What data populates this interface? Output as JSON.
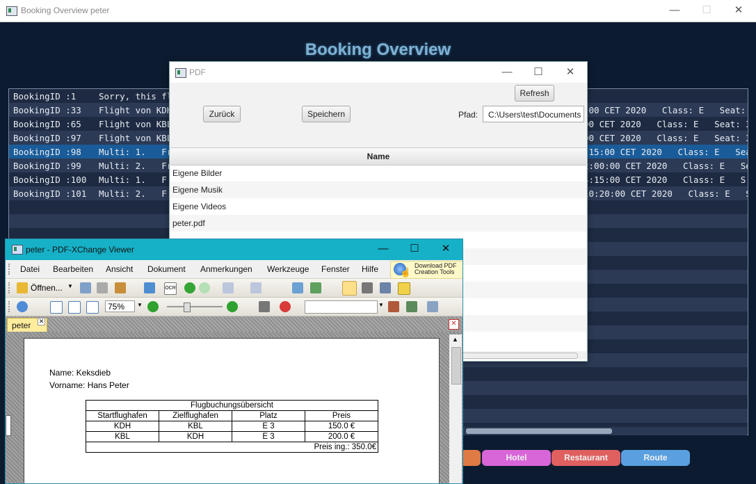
{
  "main_window": {
    "title": "Booking Overview peter",
    "heading": "Booking Overview",
    "bookings": [
      {
        "c1": "BookingID :1",
        "c2": "Sorry, this fli",
        "c3": ""
      },
      {
        "c1": "BookingID :33",
        "c2": "Flight von KDH",
        "c3": ":00 CET 2020   Class: E   Seat:"
      },
      {
        "c1": "BookingID :65",
        "c2": "Flight von KBL",
        "c3": "00 CET 2020   Class: E   Seat: 3"
      },
      {
        "c1": "BookingID :97",
        "c2": "Flight von KBL",
        "c3": "00 CET 2020   Class: E   Seat: 3"
      },
      {
        "c1": "BookingID :98",
        "c2": "Multi: 1.   Fr",
        "c3": ":15:00 CET 2020   Class: E   Sea"
      },
      {
        "c1": "BookingID :99",
        "c2": "Multi: 2.   Fr",
        "c3": "2:00:00 CET 2020   Class: E   Se"
      },
      {
        "c1": "BookingID :100",
        "c2": "Multi: 1.   F",
        "c3": "4:15:00 CET 2020   Class: E   S"
      },
      {
        "c1": "BookingID :101",
        "c2": "Multi: 2.   F",
        "c3": "10:20:00 CET 2020   Class: E   S"
      }
    ],
    "selected_index": 4,
    "nav_buttons": [
      {
        "label": "Hotel",
        "color": "#d866d8"
      },
      {
        "label": "Restaurant",
        "color": "#e06060"
      },
      {
        "label": "Route",
        "color": "#5aa0e0"
      }
    ]
  },
  "pdf_window": {
    "title": "PDF",
    "refresh_label": "Refresh",
    "back_label": "Zurück",
    "save_label": "Speichern",
    "path_label": "Pfad:",
    "path_value": "C:\\Users\\test\\Documents",
    "column_header": "Name",
    "files": [
      "Eigene Bilder",
      "Eigene Musik",
      "Eigene Videos",
      "peter.pdf"
    ]
  },
  "viewer": {
    "title": "peter - PDF-XChange Viewer",
    "menu": [
      "Datei",
      "Bearbeiten",
      "Ansicht",
      "Dokument",
      "Anmerkungen",
      "Werkzeuge",
      "Fenster",
      "Hilfe"
    ],
    "download_line1": "Download PDF",
    "download_line2": "Creation Tools",
    "open_label": "Öffnen...",
    "zoom_value": "75%",
    "tab_label": "peter",
    "document": {
      "name_line": "Name: Keksdieb",
      "vorname_line": "Vorname: Hans Peter",
      "table_title": "Flugbuchungsübersicht",
      "headers": [
        "Startflughafen",
        "Zielflughafen",
        "Platz",
        "Preis"
      ],
      "rows": [
        [
          "KDH",
          "KBL",
          "E 3",
          "150.0 €"
        ],
        [
          "KBL",
          "KDH",
          "E 3",
          "200.0 €"
        ]
      ],
      "total": "Preis ing.: 350.0€"
    }
  }
}
